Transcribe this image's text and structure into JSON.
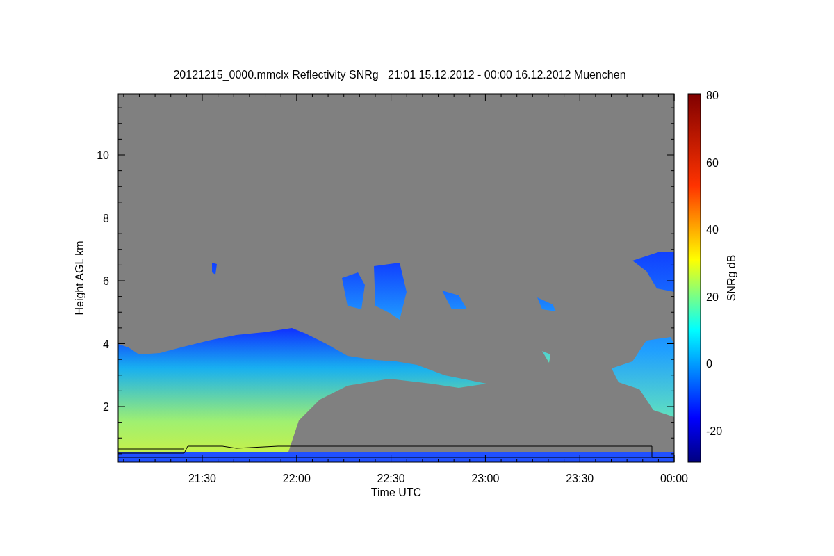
{
  "title": "20121215_0000.mmclx Reflectivity SNRg   21:01 15.12.2012 - 00:00 16.12.2012 Muenchen",
  "y_axis": {
    "label": "Height AGL km",
    "ticks": [
      "10",
      "8",
      "6",
      "4",
      "2"
    ]
  },
  "x_axis": {
    "label": "Time UTC",
    "ticks": [
      "21:30",
      "22:00",
      "22:30",
      "23:00",
      "23:30",
      "00:00"
    ]
  },
  "colorbar": {
    "label": "SNRg dB",
    "ticks": [
      "80",
      "60",
      "40",
      "20",
      "0",
      "-20"
    ]
  }
}
